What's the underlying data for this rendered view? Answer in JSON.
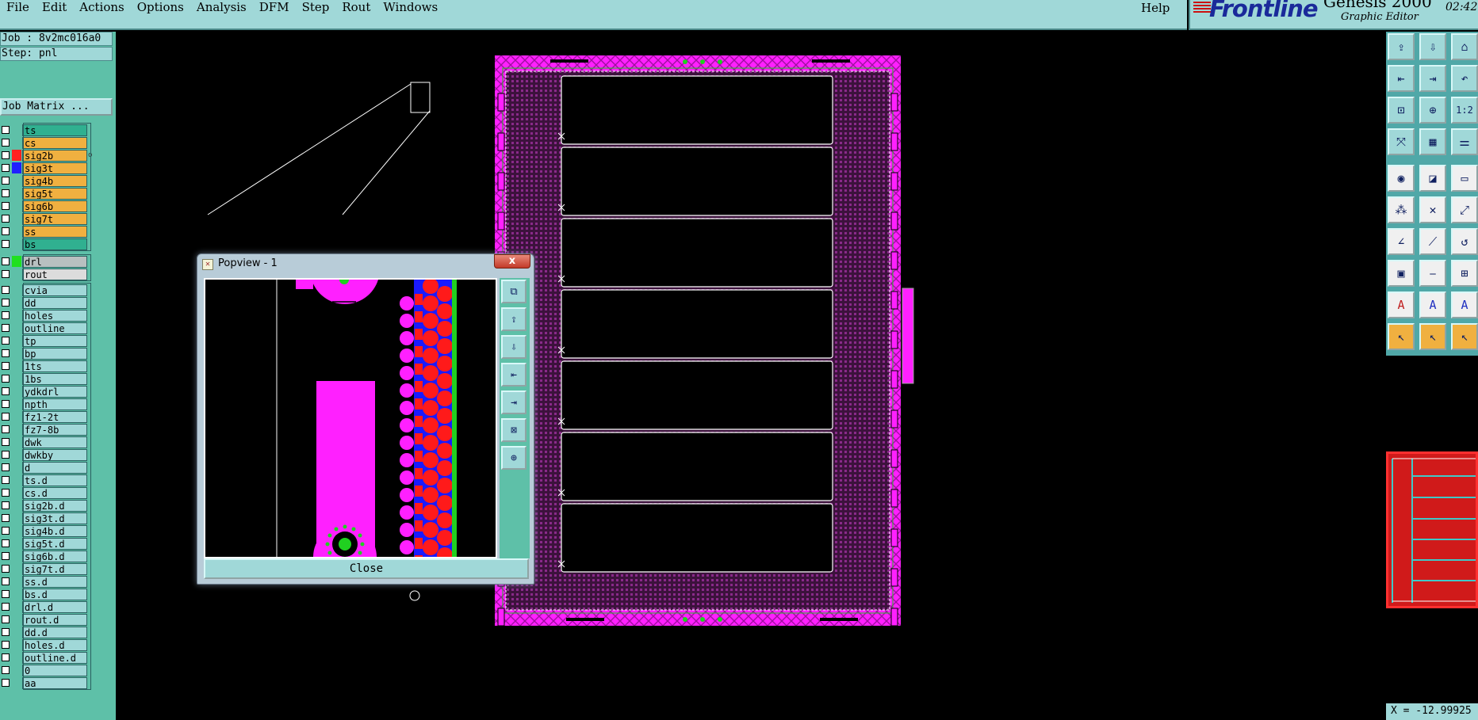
{
  "menubar": {
    "items": [
      "File",
      "Edit",
      "Actions",
      "Options",
      "Analysis",
      "DFM",
      "Step",
      "Rout",
      "Windows"
    ],
    "help": "Help"
  },
  "brand": {
    "logo": "Frontline",
    "product": "Genesis 2000",
    "subtitle": "Graphic Editor",
    "time": "02:42"
  },
  "info": {
    "job": "Job : 8v2mc016a0",
    "step": "Step: pnl",
    "job_matrix": "Job Matrix ..."
  },
  "layers": {
    "board": [
      {
        "name": "ts",
        "color": "#30b090",
        "swatch": ""
      },
      {
        "name": "cs",
        "color": "#f0b040",
        "swatch": ""
      },
      {
        "name": "sig2b",
        "color": "#f0b040",
        "swatch": "#ff2020",
        "flag": "o"
      },
      {
        "name": "sig3t",
        "color": "#f0b040",
        "swatch": "#2020ff"
      },
      {
        "name": "sig4b",
        "color": "#f0b040",
        "swatch": ""
      },
      {
        "name": "sig5t",
        "color": "#f0b040",
        "swatch": ""
      },
      {
        "name": "sig6b",
        "color": "#f0b040",
        "swatch": ""
      },
      {
        "name": "sig7t",
        "color": "#f0b040",
        "swatch": ""
      },
      {
        "name": "ss",
        "color": "#f0b040",
        "swatch": ""
      },
      {
        "name": "bs",
        "color": "#30b090",
        "swatch": ""
      }
    ],
    "drill": [
      {
        "name": "drl",
        "color": "#b8c0c0",
        "swatch": "#20e020"
      },
      {
        "name": "rout",
        "color": "#dcdcdc",
        "swatch": ""
      }
    ],
    "misc": [
      {
        "name": "cvia"
      },
      {
        "name": "dd"
      },
      {
        "name": "holes"
      },
      {
        "name": "outline"
      },
      {
        "name": "tp"
      },
      {
        "name": "bp"
      },
      {
        "name": "1ts"
      },
      {
        "name": "1bs"
      },
      {
        "name": "ydkdrl"
      },
      {
        "name": "npth"
      },
      {
        "name": "fz1-2t"
      },
      {
        "name": "fz7-8b"
      },
      {
        "name": "dwk"
      },
      {
        "name": "dwkby"
      },
      {
        "name": "d"
      },
      {
        "name": "ts.d"
      },
      {
        "name": "cs.d"
      },
      {
        "name": "sig2b.d"
      },
      {
        "name": "sig3t.d"
      },
      {
        "name": "sig4b.d"
      },
      {
        "name": "sig5t.d"
      },
      {
        "name": "sig6b.d"
      },
      {
        "name": "sig7t.d"
      },
      {
        "name": "ss.d"
      },
      {
        "name": "bs.d"
      },
      {
        "name": "drl.d"
      },
      {
        "name": "rout.d"
      },
      {
        "name": "dd.d"
      },
      {
        "name": "holes.d"
      },
      {
        "name": "outline.d"
      },
      {
        "name": "0"
      },
      {
        "name": "aa"
      }
    ],
    "misc_color": "#a0d8d8"
  },
  "toolbar": {
    "icons": [
      "open-job",
      "save-job",
      "home",
      "step-in",
      "step-out",
      "undo",
      "zoom-fit",
      "zoom-home",
      "zoom-ratio",
      "snap",
      "grid",
      "layer-colors",
      "feature-draw",
      "polygon",
      "ruler",
      "net-nodes",
      "cross",
      "point-to-point",
      "line-add",
      "line-edit",
      "arc-edit",
      "pad-select",
      "line-break",
      "pad-move",
      "text-add",
      "text-edit",
      "text-move",
      "select",
      "select-area",
      "select-last"
    ],
    "labels": [
      "⇪",
      "⇩",
      "⌂",
      "⇤",
      "⇥",
      "↶",
      "⊡",
      "⊕",
      "1:2",
      "⤧",
      "▦",
      "⚌",
      "◉",
      "◪",
      "▭",
      "⁂",
      "✕",
      "⤢",
      "∠",
      "⟋",
      "↺",
      "▣",
      "⎯",
      "⊞",
      "A",
      "A",
      "A",
      "↖",
      "↖",
      "↖"
    ],
    "ratio_label": "1:2"
  },
  "coord": {
    "text": "X = -12.99925"
  },
  "popup": {
    "title": "Popview - 1",
    "close_x": "x",
    "close_button": "Close",
    "tools": [
      "zoom-window",
      "page-up",
      "page-down",
      "page-left",
      "page-right",
      "zoom-fit",
      "zoom-home"
    ],
    "tool_glyphs": [
      "⧉",
      "⇪",
      "⇩",
      "⇤",
      "⇥",
      "⊠",
      "⊕"
    ]
  },
  "colors": {
    "panel": "#a0d8d8",
    "accent": "#5ec0a8",
    "pcb_border": "#ff20ff",
    "pcb_fill": "#501850",
    "pad_red": "#ff1a1a",
    "pad_blue": "#1a1aff",
    "selected": "#f0b040"
  }
}
